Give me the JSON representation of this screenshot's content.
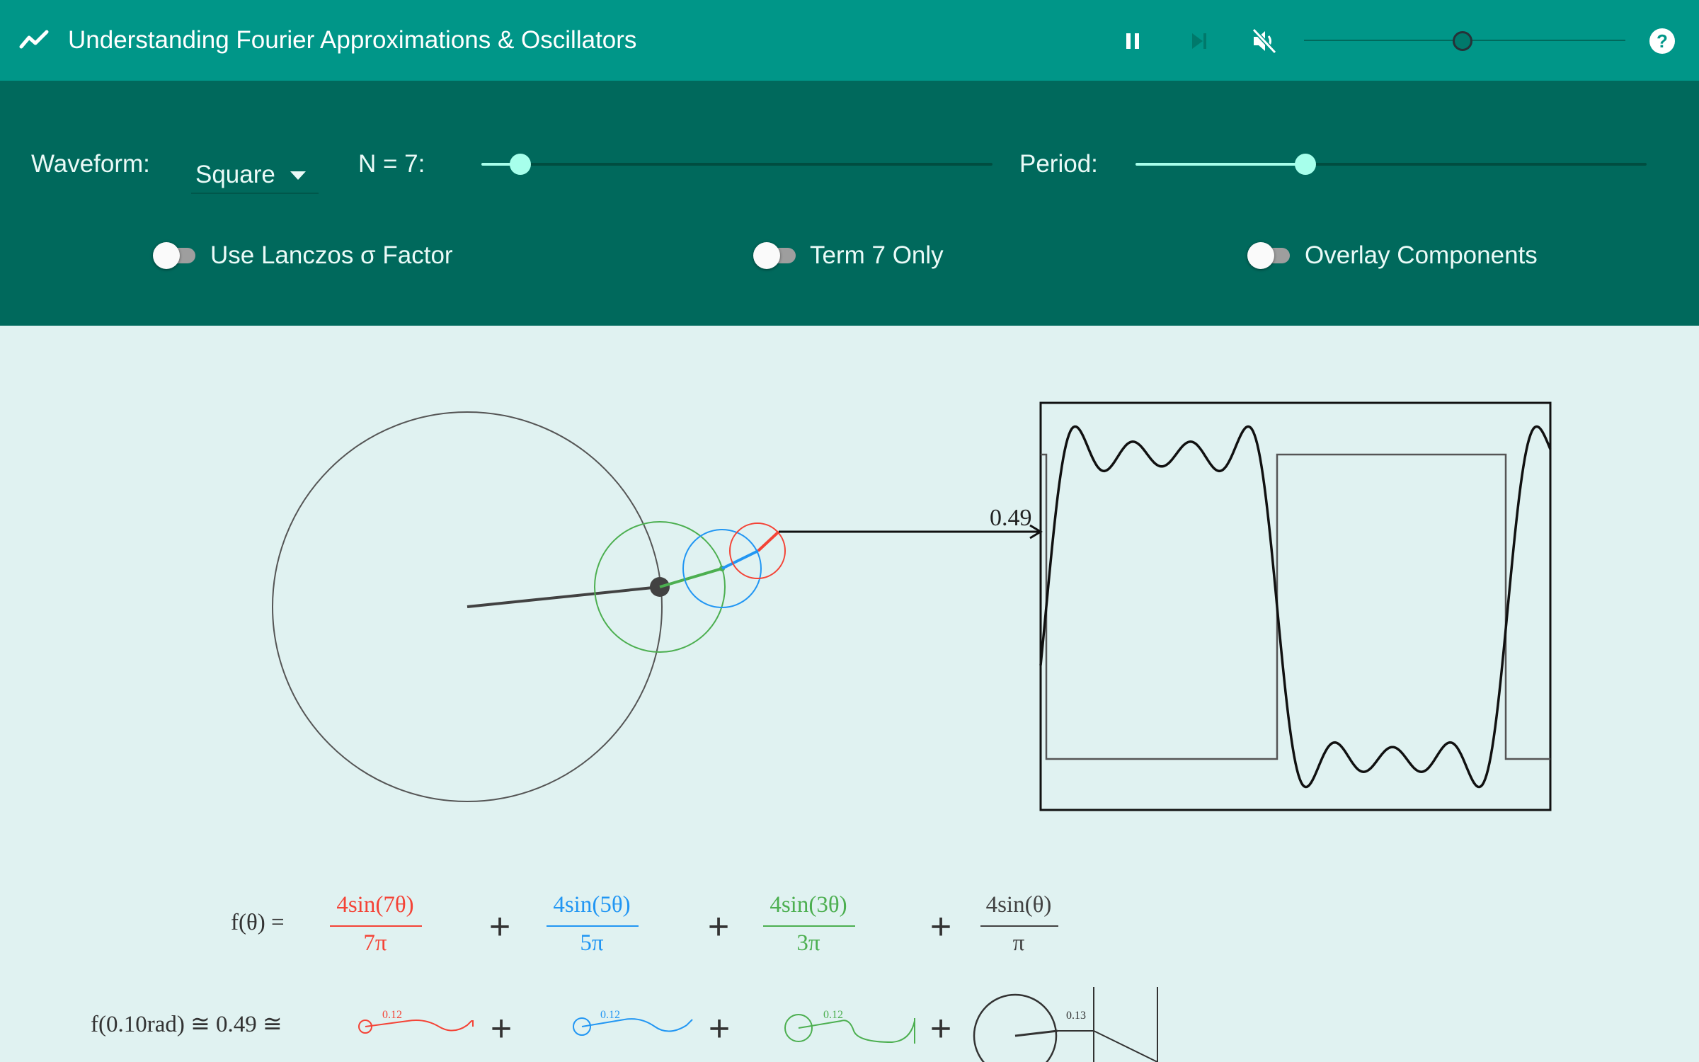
{
  "topbar": {
    "title": "Understanding Fourier Approximations & Oscillators",
    "icons": {
      "logo": "show-chart-icon",
      "pause": "pause-icon",
      "step": "skip-next-icon",
      "mute": "volume-off-icon",
      "help": "help-icon"
    },
    "volume": 0.5
  },
  "controls": {
    "waveform_label": "Waveform:",
    "waveform_value": "Square",
    "n_label": "N = 7:",
    "n_value": 7,
    "period_label": "Period:",
    "toggles": [
      {
        "label": "Use Lanczos σ Factor",
        "on": false
      },
      {
        "label": "Term 7 Only",
        "on": false
      },
      {
        "label": "Overlay Components",
        "on": false
      }
    ]
  },
  "visualization": {
    "output_value": "0.49",
    "term_colors": [
      "#f44336",
      "#2196f3",
      "#4caf50",
      "#424242"
    ]
  },
  "formula": {
    "lhs": "f(θ) =",
    "plus": "+",
    "terms": [
      {
        "numerator": "4sin(7θ)",
        "denominator": "7π",
        "color": "#f44336"
      },
      {
        "numerator": "4sin(5θ)",
        "denominator": "5π",
        "color": "#2196f3"
      },
      {
        "numerator": "4sin(3θ)",
        "denominator": "3π",
        "color": "#4caf50"
      },
      {
        "numerator": "4sin(θ)",
        "denominator": "π",
        "color": "#424242"
      }
    ]
  },
  "evaluation": {
    "lhs": "f(0.10rad) ≅ 0.49 ≅",
    "plus": "+",
    "term_values": [
      "0.12",
      "0.12",
      "0.12",
      "0.13"
    ]
  },
  "colors": {
    "appbar": "#009688",
    "controls": "#00695c",
    "stage": "#e0f2f1",
    "accent": "#a7ffeb"
  }
}
